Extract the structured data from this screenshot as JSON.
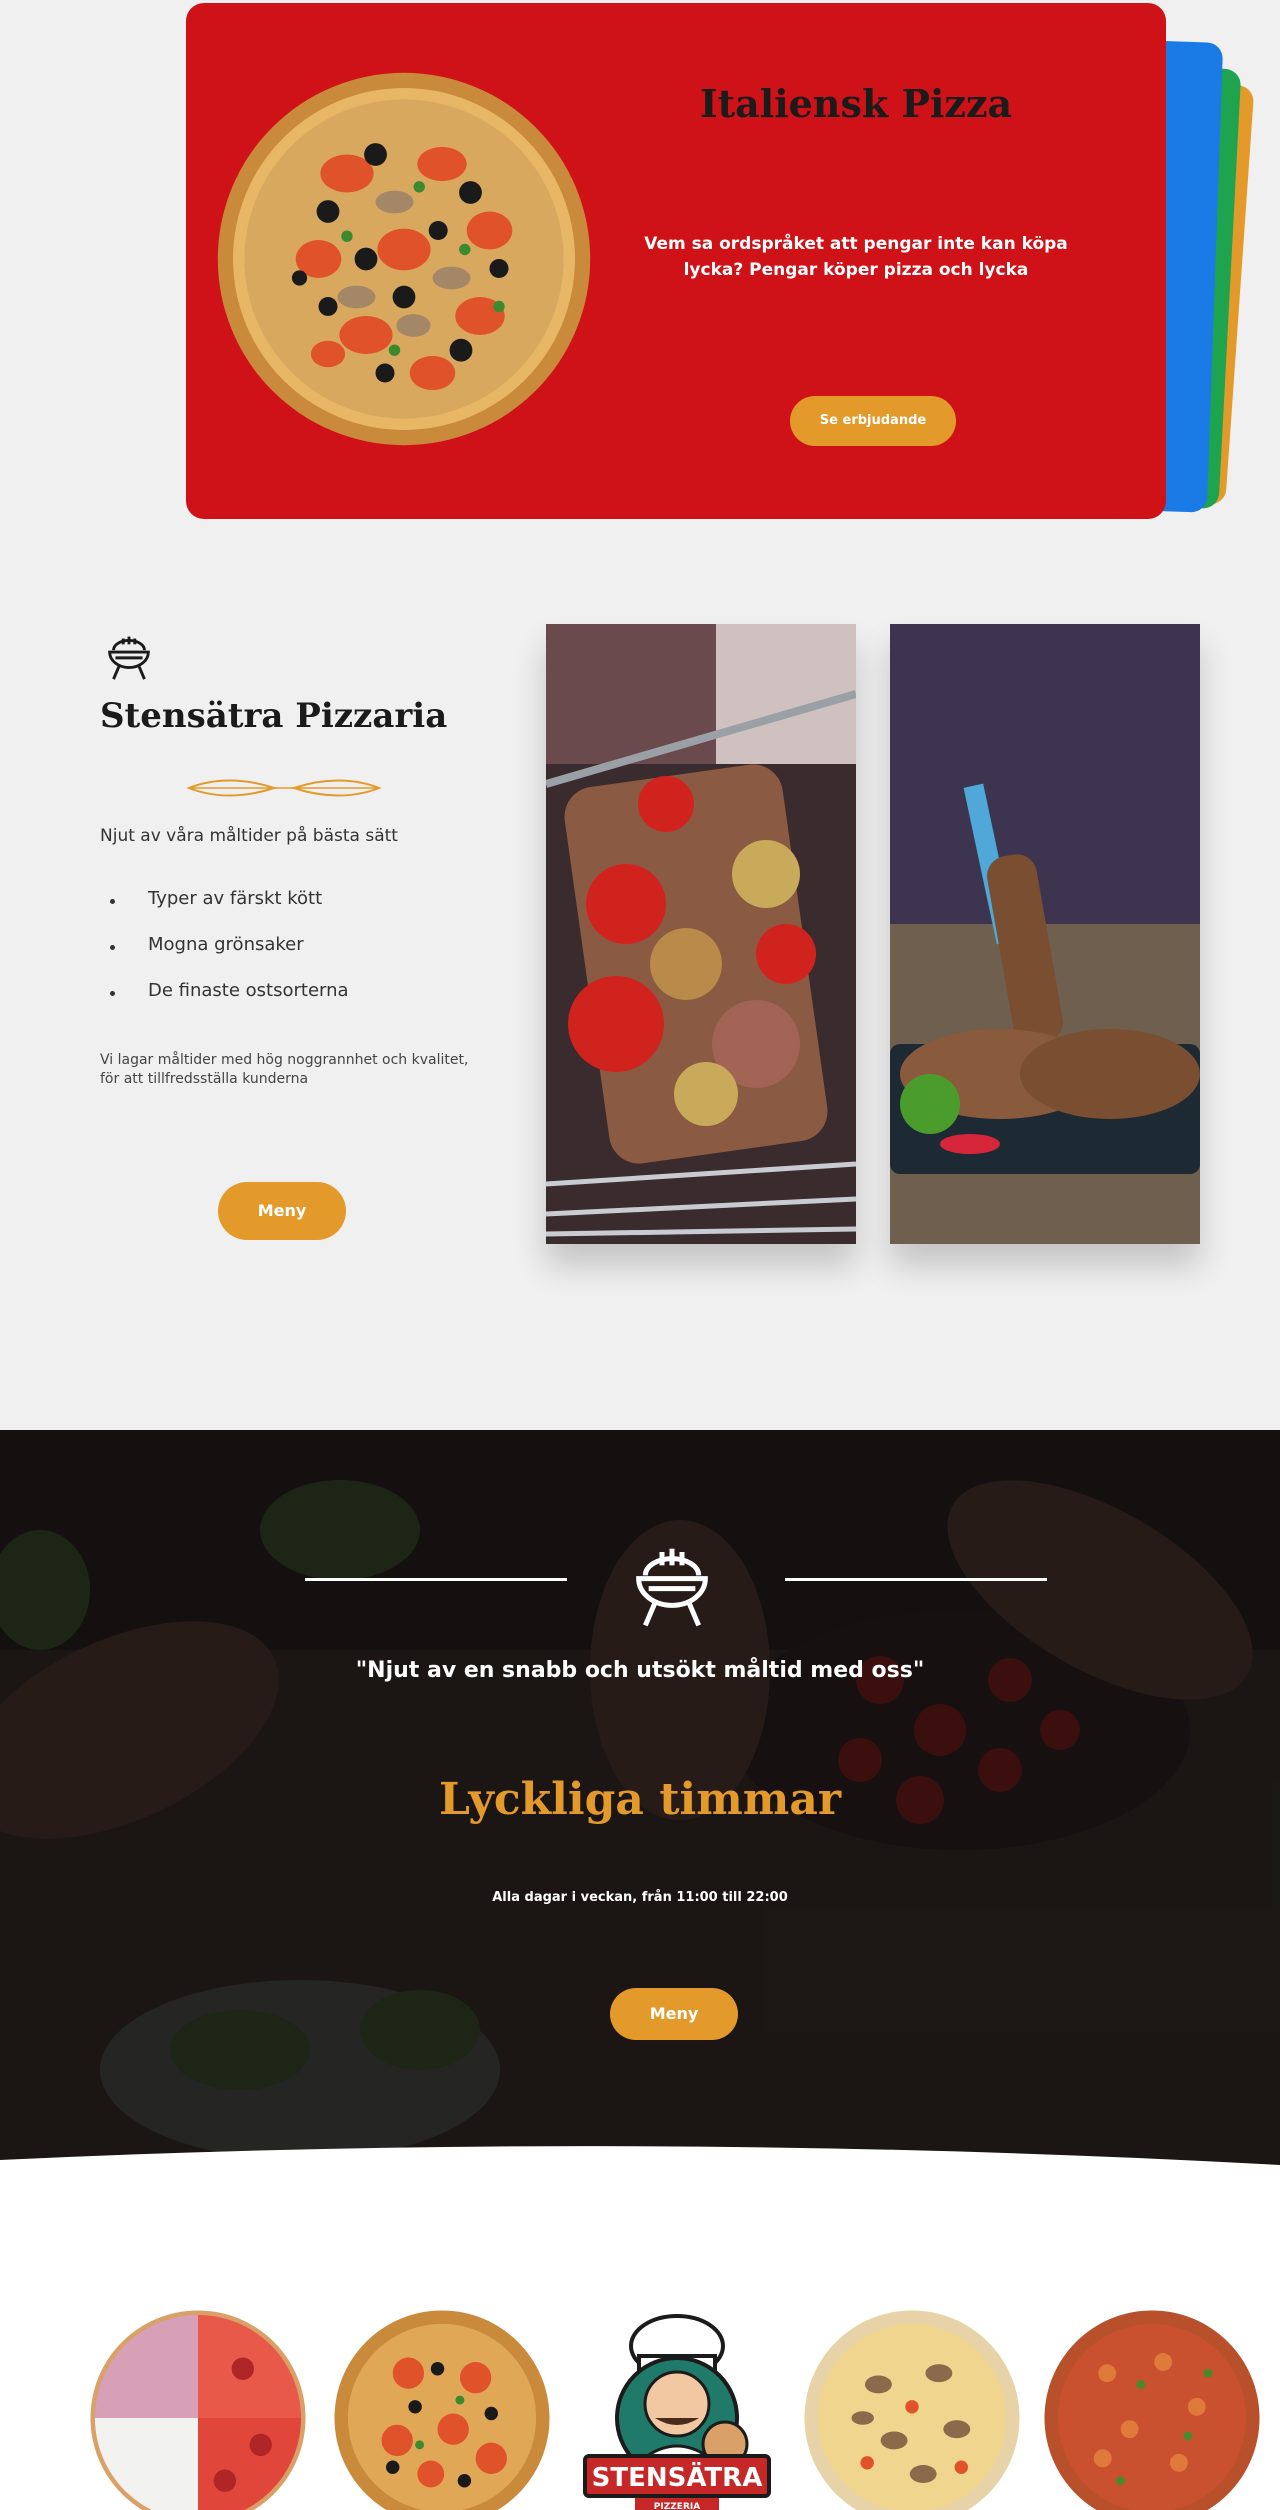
{
  "hero": {
    "title": "Italiensk Pizza",
    "text": "Vem sa ordspråket att pengar inte kan köpa lycka? Pengar köper pizza och lycka",
    "button": "Se erbjudande",
    "card_color": "#cf1218",
    "stack_colors": [
      "#1a7be6",
      "#1ea44f",
      "#e39a2b"
    ]
  },
  "about": {
    "title": "Stensätra Pizzaria",
    "subtitle": "Njut av våra måltider på bästa sätt",
    "features": [
      "Typer av färskt kött",
      "Mogna grönsaker",
      "De finaste ostsorterna"
    ],
    "description": "Vi lagar måltider med hög noggrannhet och kvalitet, för att tillfredsställa kunderna",
    "button": "Meny"
  },
  "happy_hour": {
    "quote": "\"Njut av en snabb och utsökt måltid med oss\"",
    "title": "Lyckliga timmar",
    "hours": "Alla dagar i veckan, från 11:00 till 22:00",
    "button": "Meny"
  },
  "logo": {
    "text": "STENSÄTRA",
    "tagline": "PIZZERIA"
  },
  "colors": {
    "accent": "#e39a2b",
    "red": "#cf1218",
    "background": "#f0f0f0"
  }
}
